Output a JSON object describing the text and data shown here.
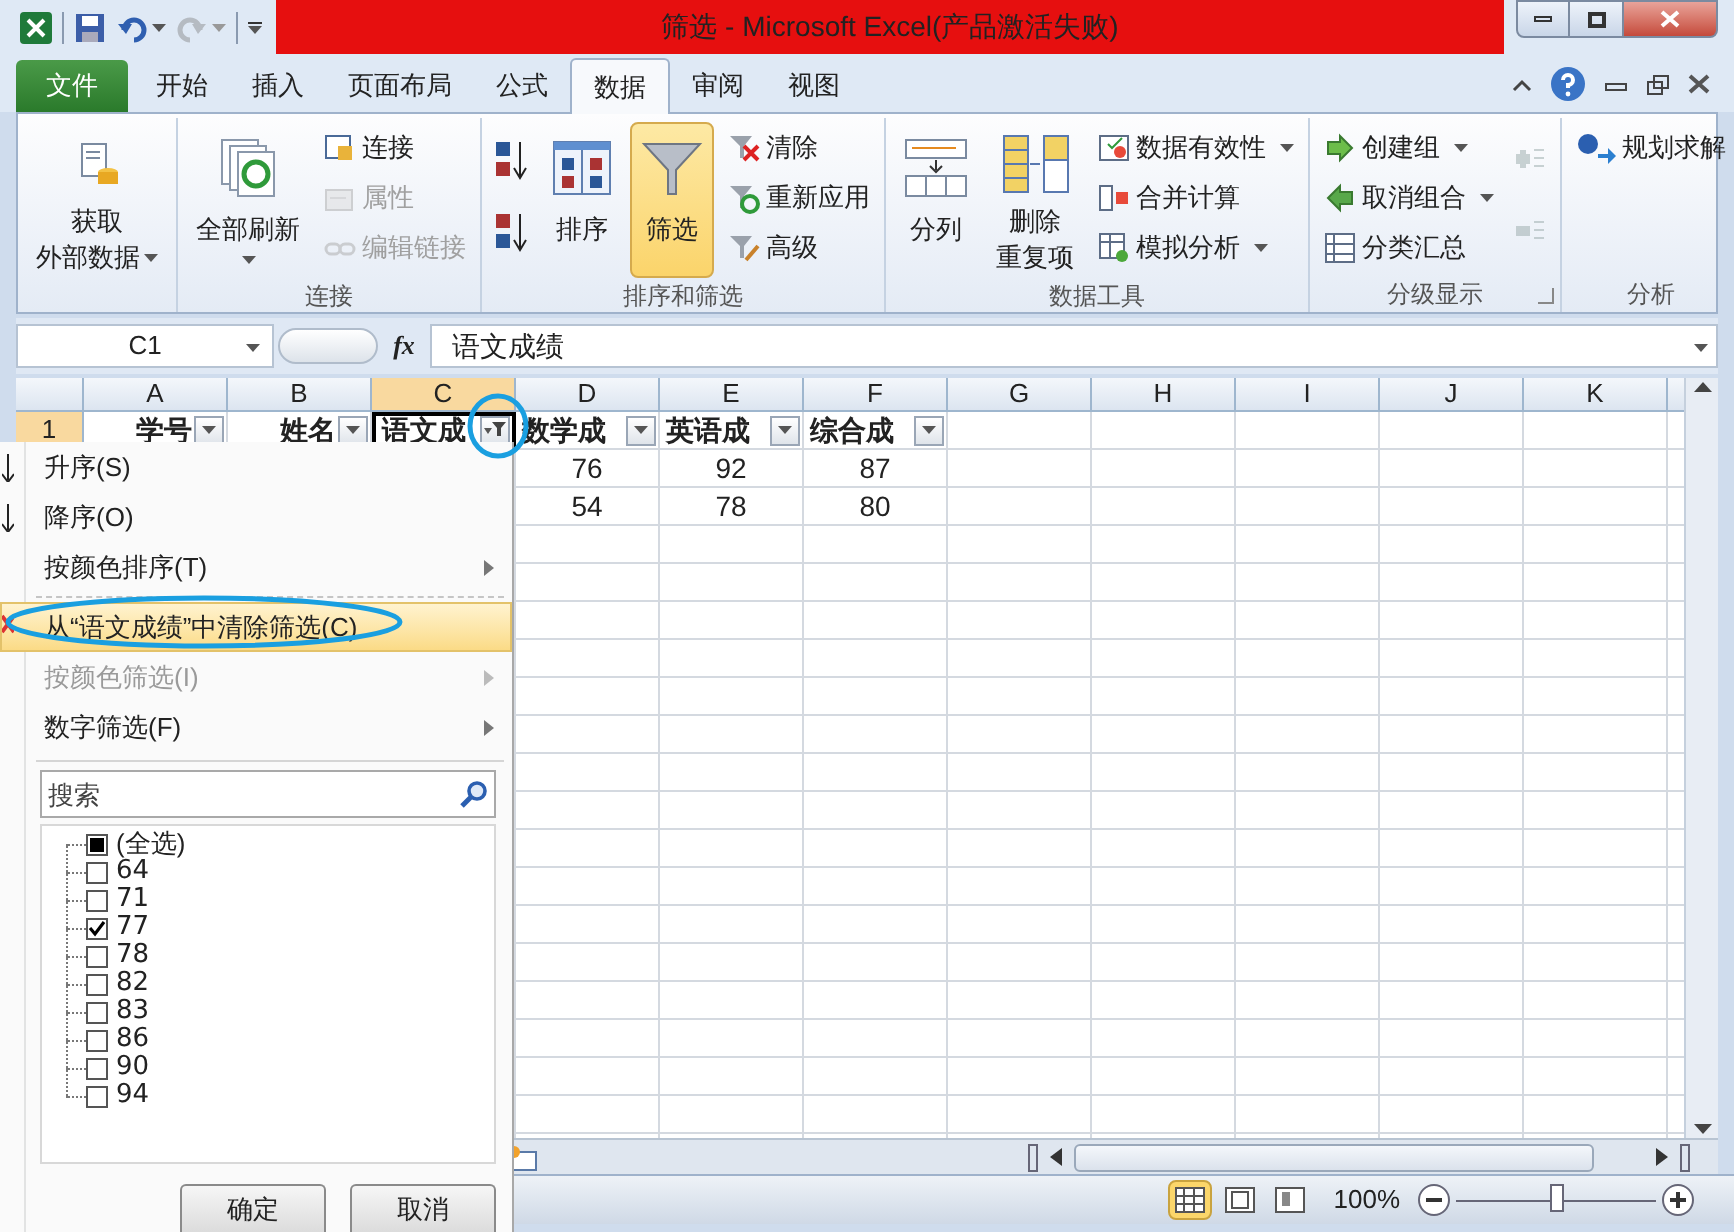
{
  "window": {
    "title": "筛选 - Microsoft Excel(产品激活失败)"
  },
  "quick_access": [
    {
      "kind": "save",
      "disabled": false
    },
    {
      "kind": "undo",
      "disabled": false
    },
    {
      "kind": "redo",
      "disabled": true
    }
  ],
  "ribbon_tabs": [
    {
      "label": "文件",
      "kind": "file",
      "selected": false
    },
    {
      "label": "开始",
      "kind": "tab",
      "selected": false
    },
    {
      "label": "插入",
      "kind": "tab",
      "selected": false
    },
    {
      "label": "页面布局",
      "kind": "tab",
      "selected": false
    },
    {
      "label": "公式",
      "kind": "tab",
      "selected": false
    },
    {
      "label": "数据",
      "kind": "tab",
      "selected": true
    },
    {
      "label": "审阅",
      "kind": "tab",
      "selected": false
    },
    {
      "label": "视图",
      "kind": "tab",
      "selected": false
    }
  ],
  "ribbon_groups": [
    {
      "items": [
        {
          "kind": "large",
          "lines": [
            "获取",
            "外部数据"
          ],
          "dropdown": true,
          "disabled": false,
          "pressed": false
        }
      ]
    },
    {
      "label": "连接",
      "items": [
        {
          "kind": "large",
          "lines": [
            "全部刷新"
          ],
          "dropdown": true,
          "disabled": false,
          "pressed": false
        },
        {
          "kind": "small",
          "label": "连接",
          "dropdown": false,
          "disabled": false,
          "pressed": false
        },
        {
          "kind": "small",
          "label": "属性",
          "dropdown": false,
          "disabled": true,
          "pressed": false
        },
        {
          "kind": "small",
          "label": "编辑链接",
          "dropdown": false,
          "disabled": true,
          "pressed": false
        }
      ]
    },
    {
      "label": "排序和筛选",
      "items": [
        {
          "kind": "icon",
          "dropdown": false,
          "disabled": false,
          "pressed": false
        },
        {
          "kind": "icon",
          "dropdown": false,
          "disabled": false,
          "pressed": false
        },
        {
          "kind": "large",
          "lines": [
            "排序"
          ],
          "dropdown": false,
          "disabled": false,
          "pressed": false
        },
        {
          "kind": "large",
          "lines": [
            "筛选"
          ],
          "dropdown": false,
          "disabled": false,
          "pressed": true
        },
        {
          "kind": "small",
          "label": "清除",
          "dropdown": false,
          "disabled": false,
          "pressed": false
        },
        {
          "kind": "small",
          "label": "重新应用",
          "dropdown": false,
          "disabled": false,
          "pressed": false
        },
        {
          "kind": "small",
          "label": "高级",
          "dropdown": false,
          "disabled": false,
          "pressed": false
        }
      ]
    },
    {
      "label": "数据工具",
      "items": [
        {
          "kind": "large",
          "lines": [
            "分列"
          ],
          "dropdown": false,
          "disabled": false,
          "pressed": false
        },
        {
          "kind": "large",
          "lines": [
            "删除",
            "重复项"
          ],
          "dropdown": false,
          "disabled": false,
          "pressed": false
        },
        {
          "kind": "small",
          "label": "数据有效性",
          "dropdown": true,
          "disabled": false,
          "pressed": false
        },
        {
          "kind": "small",
          "label": "合并计算",
          "dropdown": false,
          "disabled": false,
          "pressed": false
        },
        {
          "kind": "small",
          "label": "模拟分析",
          "dropdown": true,
          "disabled": false,
          "pressed": false
        }
      ]
    },
    {
      "label": "分级显示",
      "launcher": true,
      "items": [
        {
          "kind": "small",
          "label": "创建组",
          "dropdown": true,
          "disabled": false,
          "pressed": false
        },
        {
          "kind": "small",
          "label": "取消组合",
          "dropdown": true,
          "disabled": false,
          "pressed": false
        },
        {
          "kind": "small",
          "label": "分类汇总",
          "dropdown": false,
          "disabled": false,
          "pressed": false
        },
        {
          "kind": "icon",
          "dropdown": false,
          "disabled": true,
          "pressed": false
        },
        {
          "kind": "icon",
          "dropdown": false,
          "disabled": true,
          "pressed": false
        }
      ]
    },
    {
      "label": "分析",
      "items": [
        {
          "kind": "small",
          "label": "规划求解",
          "dropdown": false,
          "disabled": false,
          "pressed": false
        }
      ]
    }
  ],
  "formula_bar": {
    "name_box": "C1",
    "function_label": "fx",
    "formula": "语文成绩"
  },
  "sheet": {
    "columns": [
      {
        "label": "A",
        "selected": false
      },
      {
        "label": "B",
        "selected": false
      },
      {
        "label": "C",
        "selected": true
      },
      {
        "label": "D",
        "selected": false
      },
      {
        "label": "E",
        "selected": false
      },
      {
        "label": "F",
        "selected": false
      },
      {
        "label": "G",
        "selected": false
      },
      {
        "label": "H",
        "selected": false
      },
      {
        "label": "I",
        "selected": false
      },
      {
        "label": "J",
        "selected": false
      },
      {
        "label": "K",
        "selected": false
      }
    ],
    "header_row": {
      "label": "1",
      "selected": true,
      "cells": [
        {
          "text": "学号",
          "filtered": false,
          "selected": false
        },
        {
          "text": "姓名",
          "filtered": false,
          "selected": false
        },
        {
          "text": "语文成",
          "filtered": true,
          "selected": true
        },
        {
          "text": "数学成",
          "filtered": false,
          "selected": false
        },
        {
          "text": "英语成",
          "filtered": false,
          "selected": false
        },
        {
          "text": "综合成",
          "filtered": false,
          "selected": false
        }
      ]
    },
    "data_rows": [
      {
        "cells": [
          null,
          null,
          null,
          "76",
          "92",
          "87"
        ]
      },
      {
        "cells": [
          null,
          null,
          null,
          "54",
          "78",
          "80"
        ]
      }
    ]
  },
  "filter_menu": {
    "items": [
      {
        "kind": "command",
        "label": "升序(S)",
        "disabled": false,
        "selected": false
      },
      {
        "kind": "command",
        "label": "降序(O)",
        "disabled": false,
        "selected": false
      },
      {
        "kind": "submenu",
        "label": "按颜色排序(T)",
        "disabled": false,
        "selected": false
      },
      {
        "kind": "separator"
      },
      {
        "kind": "command",
        "label": "从“语文成绩”中清除筛选(C)",
        "disabled": false,
        "selected": true
      },
      {
        "kind": "submenu",
        "label": "按颜色筛选(I)",
        "disabled": true,
        "selected": false
      },
      {
        "kind": "submenu",
        "label": "数字筛选(F)",
        "disabled": false,
        "selected": false
      }
    ],
    "search": {
      "placeholder": "搜索"
    },
    "values": [
      {
        "label": "(全选)",
        "checked": false,
        "partial": true,
        "children": [
          {
            "label": "64",
            "checked": false
          },
          {
            "label": "71",
            "checked": false
          },
          {
            "label": "77",
            "checked": true
          },
          {
            "label": "78",
            "checked": false
          },
          {
            "label": "82",
            "checked": false
          },
          {
            "label": "83",
            "checked": false
          },
          {
            "label": "86",
            "checked": false
          },
          {
            "label": "90",
            "checked": false
          },
          {
            "label": "94",
            "checked": false
          }
        ]
      }
    ],
    "buttons": [
      "确定",
      "取消"
    ]
  },
  "status_bar": {
    "views": [
      {
        "kind": "normal",
        "selected": true
      },
      {
        "kind": "page_layout",
        "selected": false
      },
      {
        "kind": "page_break",
        "selected": false
      }
    ],
    "zoom": "100%",
    "zoom_slider": {
      "level": 0.5
    }
  }
}
